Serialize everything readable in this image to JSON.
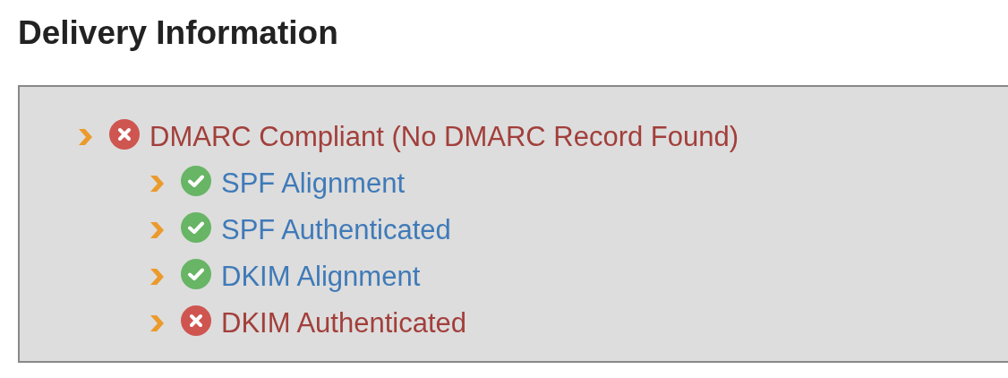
{
  "title": "Delivery Information",
  "tree": [
    {
      "label": "DMARC Compliant (No DMARC Record Found)",
      "passed": false,
      "expanded": false,
      "children": [
        {
          "label": "SPF Alignment",
          "passed": true,
          "expanded": false
        },
        {
          "label": "SPF Authenticated",
          "passed": true,
          "expanded": false
        },
        {
          "label": "DKIM Alignment",
          "passed": true,
          "expanded": false
        },
        {
          "label": "DKIM Authenticated",
          "passed": false,
          "expanded": false
        }
      ]
    }
  ]
}
